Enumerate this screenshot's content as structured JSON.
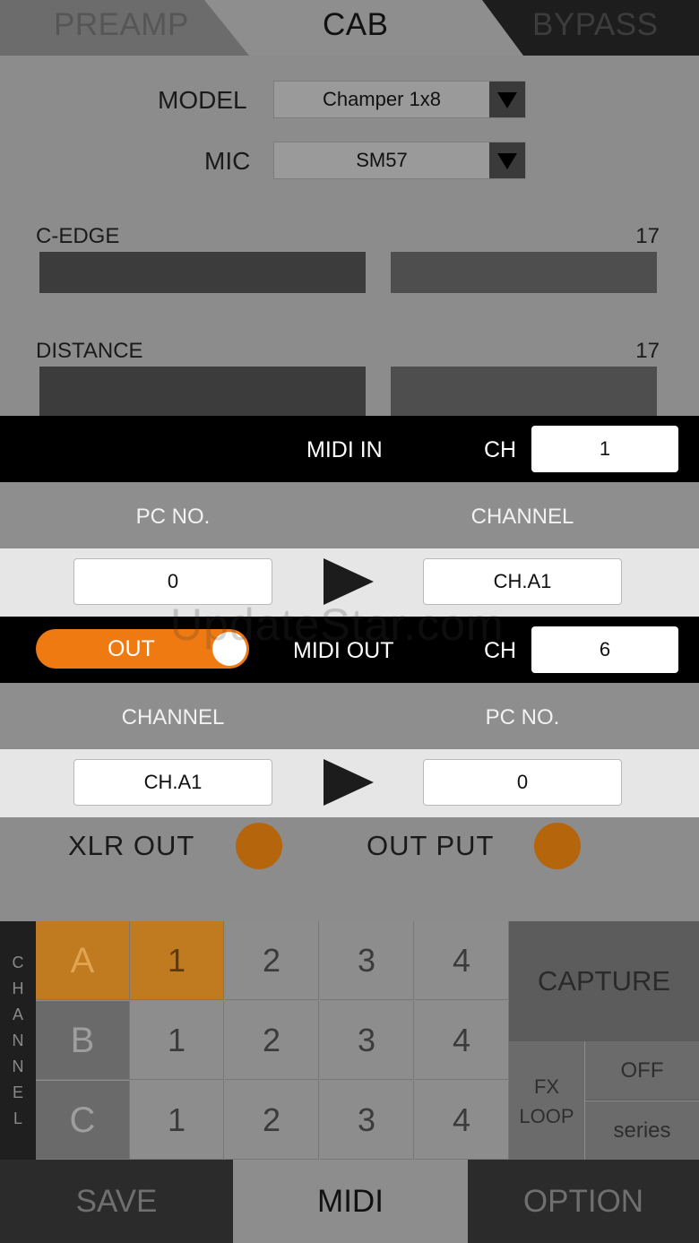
{
  "tabs": {
    "preamp": "PREAMP",
    "cab": "CAB",
    "bypass": "BYPASS"
  },
  "cab": {
    "model_label": "MODEL",
    "model_value": "Champer 1x8",
    "mic_label": "MIC",
    "mic_value": "SM57",
    "params": [
      {
        "label": "C-EDGE",
        "value": "17"
      },
      {
        "label": "DISTANCE",
        "value": "17"
      }
    ]
  },
  "midi_in": {
    "title": "MIDI IN",
    "ch_label": "CH",
    "ch_value": "1",
    "col_left": "PC NO.",
    "col_right": "CHANNEL",
    "pc_value": "0",
    "channel_value": "CH.A1"
  },
  "midi_out": {
    "toggle_label": "OUT",
    "title": "MIDI OUT",
    "ch_label": "CH",
    "ch_value": "6",
    "col_left": "CHANNEL",
    "col_right": "PC NO.",
    "channel_value": "CH.A1",
    "pc_value": "0"
  },
  "outputs": {
    "xlr": "XLR OUT",
    "output": "OUT PUT"
  },
  "channel_grid": {
    "strip_letters": [
      "C",
      "H",
      "A",
      "N",
      "N",
      "E",
      "L"
    ],
    "rows": [
      {
        "letter": "A",
        "cells": [
          "1",
          "2",
          "3",
          "4"
        ]
      },
      {
        "letter": "B",
        "cells": [
          "1",
          "2",
          "3",
          "4"
        ]
      },
      {
        "letter": "C",
        "cells": [
          "1",
          "2",
          "3",
          "4"
        ]
      }
    ],
    "capture": "CAPTURE",
    "fx_loop_line1": "FX",
    "fx_loop_line2": "LOOP",
    "fx_off": "OFF",
    "fx_series": "series"
  },
  "nav": {
    "save": "SAVE",
    "midi": "MIDI",
    "option": "OPTION"
  },
  "watermark": "UpdateStar.com",
  "colors": {
    "accent": "#f07a12",
    "active_cell": "#c07a1f",
    "led": "#b5650b"
  }
}
